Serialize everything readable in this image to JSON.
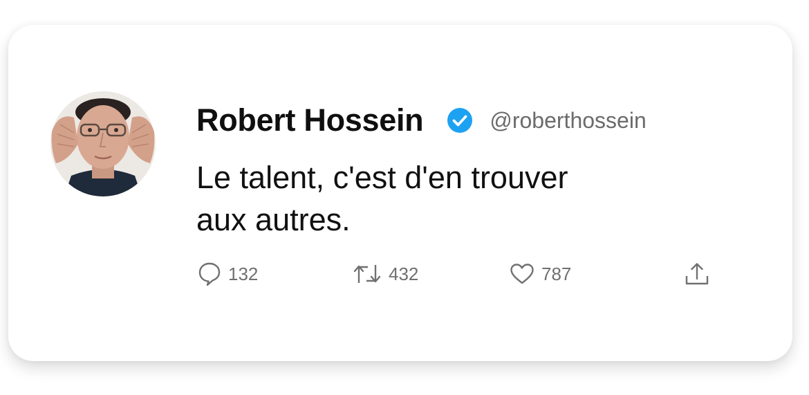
{
  "tweet": {
    "author": {
      "name": "Robert Hossein",
      "handle": "@roberthossein",
      "verified": true
    },
    "text_lines": [
      "Le talent, c'est d'en trouver",
      "aux autres."
    ],
    "stats": {
      "replies": "132",
      "retweets": "432",
      "likes": "787"
    },
    "colors": {
      "verified_badge": "#1da1f2",
      "text": "#111111",
      "secondary_text": "#707070"
    },
    "icons": {
      "reply": "speech-bubble",
      "retweet": "retweet-arrows",
      "like": "heart-outline",
      "share": "upload-arrow"
    }
  }
}
